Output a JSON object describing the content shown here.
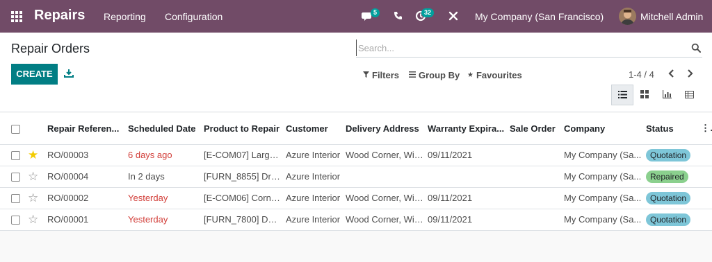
{
  "app": {
    "name": "Repairs",
    "menu": [
      "Reporting",
      "Configuration"
    ],
    "messages_count": "5",
    "activities_count": "32",
    "company": "My Company (San Francisco)",
    "user": "Mitchell Admin"
  },
  "control": {
    "title": "Repair Orders",
    "search_placeholder": "Search...",
    "create_label": "CREATE",
    "filters_label": "Filters",
    "groupby_label": "Group By",
    "favourites_label": "Favourites",
    "pager": "1-4 / 4"
  },
  "table": {
    "columns": [
      "Repair Referen...",
      "Scheduled Date",
      "Product to Repair",
      "Customer",
      "Delivery Address",
      "Warranty Expira...",
      "Sale Order",
      "Company",
      "Status"
    ],
    "rows": [
      {
        "starred": true,
        "ref": "RO/00003",
        "date": "6 days ago",
        "date_overdue": true,
        "product": "[E-COM07] Large ...",
        "customer": "Azure Interior",
        "address": "Wood Corner, Wil...",
        "warranty": "09/11/2021",
        "sale_order": "",
        "company": "My Company (Sa...",
        "status": "Quotation",
        "status_kind": "quotation"
      },
      {
        "starred": false,
        "ref": "RO/00004",
        "date": "In 2 days",
        "date_overdue": false,
        "product": "[FURN_8855] Dra...",
        "customer": "Azure Interior",
        "address": "",
        "warranty": "",
        "sale_order": "",
        "company": "My Company (Sa...",
        "status": "Repaired",
        "status_kind": "repaired"
      },
      {
        "starred": false,
        "ref": "RO/00002",
        "date": "Yesterday",
        "date_overdue": true,
        "product": "[E-COM06] Corne...",
        "customer": "Azure Interior",
        "address": "Wood Corner, Wil...",
        "warranty": "09/11/2021",
        "sale_order": "",
        "company": "My Company (Sa...",
        "status": "Quotation",
        "status_kind": "quotation"
      },
      {
        "starred": false,
        "ref": "RO/00001",
        "date": "Yesterday",
        "date_overdue": true,
        "product": "[FURN_7800] Des...",
        "customer": "Azure Interior",
        "address": "Wood Corner, Wil...",
        "warranty": "09/11/2021",
        "sale_order": "",
        "company": "My Company (Sa...",
        "status": "Quotation",
        "status_kind": "quotation"
      }
    ]
  },
  "colors": {
    "brand": "#714b67",
    "primary": "#017e84",
    "danger": "#d23f3a",
    "quotation": "#7ec6d8",
    "repaired": "#8bd08e",
    "star": "#f3cc00"
  },
  "icons": [
    "apps-icon",
    "chat-icon",
    "phone-icon",
    "activity-icon",
    "tools-icon",
    "search-icon",
    "download-icon",
    "filter-icon",
    "groupby-icon",
    "star-icon",
    "chevron-left-icon",
    "chevron-right-icon",
    "list-view-icon",
    "kanban-view-icon",
    "graph-view-icon",
    "pivot-view-icon",
    "kebab-icon"
  ]
}
